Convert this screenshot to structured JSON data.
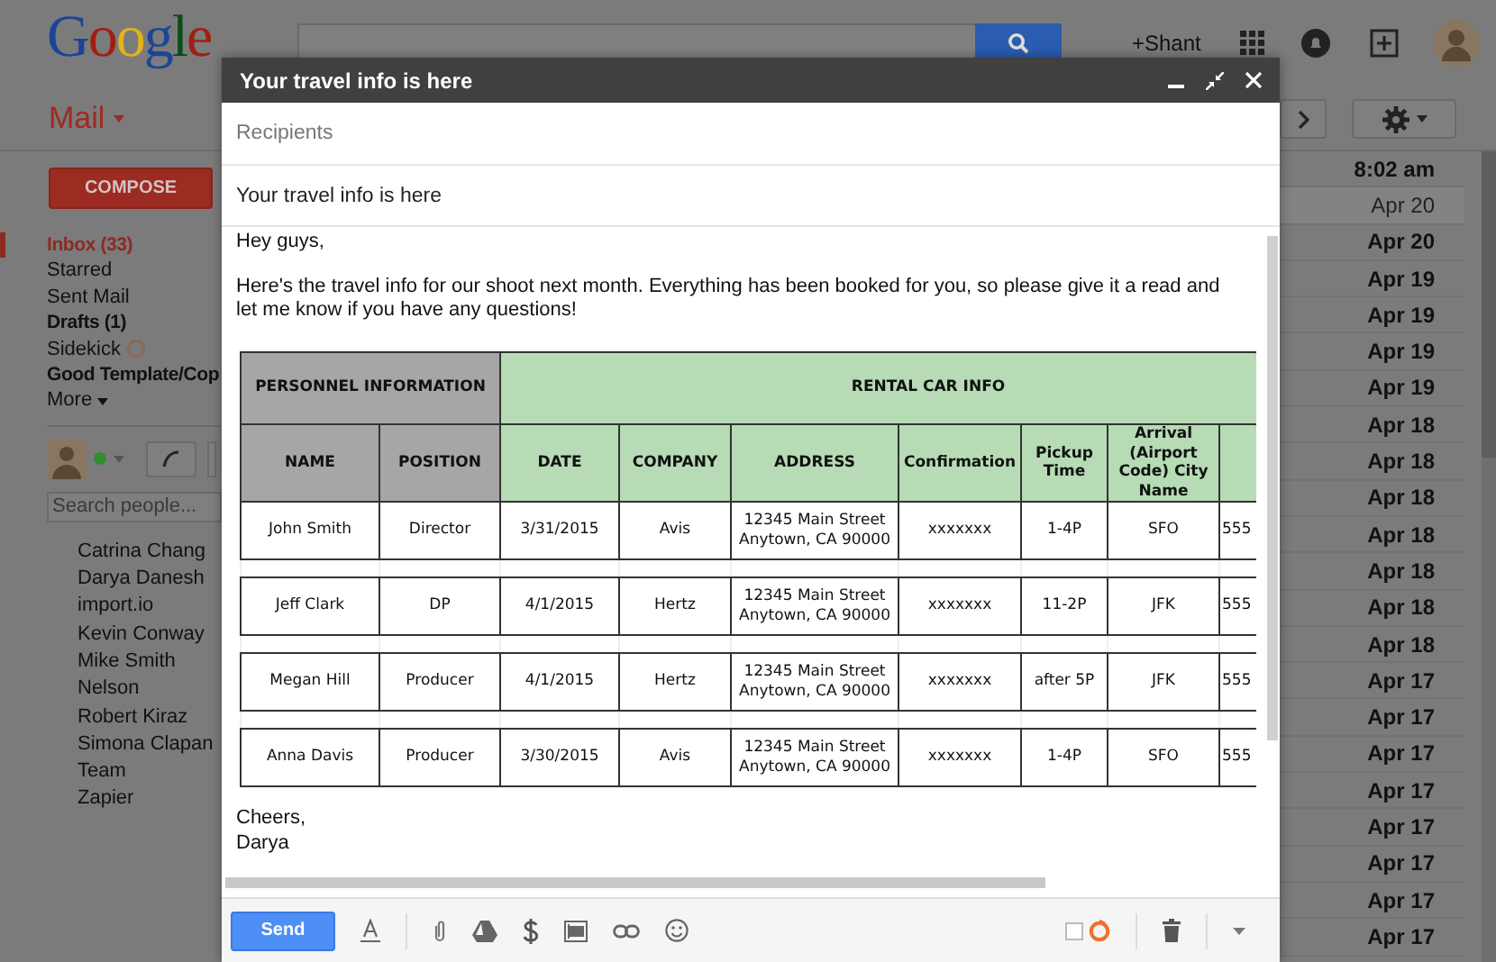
{
  "header": {
    "logo": "Google",
    "user": "+Shant"
  },
  "toolbar": {
    "app_menu": "Mail"
  },
  "sidebar": {
    "compose": "COMPOSE",
    "labels": [
      {
        "label": "Inbox (33)",
        "selected": true,
        "unread": true,
        "kind": "label"
      },
      {
        "label": "Starred",
        "selected": false,
        "unread": false,
        "kind": "label"
      },
      {
        "label": "Sent Mail",
        "selected": false,
        "unread": false,
        "kind": "label"
      },
      {
        "label": "Drafts (1)",
        "selected": false,
        "unread": true,
        "kind": "label"
      },
      {
        "label": "Sidekick",
        "selected": false,
        "unread": false,
        "kind": "addon"
      },
      {
        "label": "Good Template/Cop",
        "selected": false,
        "unread": true,
        "kind": "label"
      },
      {
        "label": "More",
        "selected": false,
        "unread": false,
        "kind": "more"
      }
    ]
  },
  "chat": {
    "search_placeholder": "Search people...",
    "contacts": [
      "Catrina Chang",
      "Darya Danesh",
      "import.io",
      "Kevin Conway",
      "Mike Smith",
      "Nelson",
      "Robert Kiraz",
      "Simona Clapan",
      "Team",
      "Zapier"
    ]
  },
  "message_list": {
    "rows": [
      {
        "date": "8:02 am",
        "unread": true
      },
      {
        "date": "Apr 20",
        "unread": false
      },
      {
        "date": "Apr 20",
        "unread": true
      },
      {
        "date": "Apr 19",
        "unread": true
      },
      {
        "date": "Apr 19",
        "unread": true
      },
      {
        "date": "Apr 19",
        "unread": true
      },
      {
        "date": "Apr 19",
        "unread": true
      },
      {
        "date": "Apr 18",
        "unread": true
      },
      {
        "date": "Apr 18",
        "unread": true
      },
      {
        "date": "Apr 18",
        "unread": true
      },
      {
        "date": "Apr 18",
        "unread": true
      },
      {
        "date": "Apr 18",
        "unread": true
      },
      {
        "date": "Apr 18",
        "unread": true
      },
      {
        "date": "Apr 18",
        "unread": true
      },
      {
        "date": "Apr 17",
        "unread": true
      },
      {
        "date": "Apr 17",
        "unread": true
      },
      {
        "date": "Apr 17",
        "unread": true
      },
      {
        "date": "Apr 17",
        "unread": true
      },
      {
        "date": "Apr 17",
        "unread": true
      },
      {
        "date": "Apr 17",
        "unread": true
      },
      {
        "date": "Apr 17",
        "unread": true
      },
      {
        "date": "Apr 17",
        "unread": true
      }
    ]
  },
  "compose": {
    "title": "Your travel info is here",
    "recipients_placeholder": "Recipients",
    "subject": "Your travel info is here",
    "greeting": "Hey guys,",
    "body": "Here's the travel info for our shoot next month. Everything has been booked for you, so please give it a read and let me know if you have any questions!",
    "table": {
      "groups": [
        {
          "label": "PERSONNEL INFORMATION",
          "color": "#a6a6a6",
          "columns": [
            "NAME",
            "POSITION"
          ]
        },
        {
          "label": "RENTAL CAR INFO",
          "color": "#b6dbb5",
          "columns": [
            "DATE",
            "COMPANY",
            "ADDRESS",
            "Confirmation",
            "Pickup Time",
            "Arrival (Airport Code) City Name",
            ""
          ]
        }
      ],
      "rows": [
        [
          "John Smith",
          "Director",
          "3/31/2015",
          "Avis",
          "12345 Main Street Anytown, CA 90000",
          "xxxxxxx",
          "1-4P",
          "SFO",
          "555"
        ],
        [
          "Jeff Clark",
          "DP",
          "4/1/2015",
          "Hertz",
          "12345 Main Street Anytown, CA 90000",
          "xxxxxxx",
          "11-2P",
          "JFK",
          "555"
        ],
        [
          "Megan Hill",
          "Producer",
          "4/1/2015",
          "Hertz",
          "12345 Main Street Anytown, CA 90000",
          "xxxxxxx",
          "after 5P",
          "JFK",
          "555"
        ],
        [
          "Anna Davis",
          "Producer",
          "3/30/2015",
          "Avis",
          "12345 Main Street Anytown, CA 90000",
          "xxxxxxx",
          "1-4P",
          "SFO",
          "555"
        ]
      ]
    },
    "signoff": [
      "Cheers,",
      "Darya"
    ],
    "send": "Send"
  }
}
